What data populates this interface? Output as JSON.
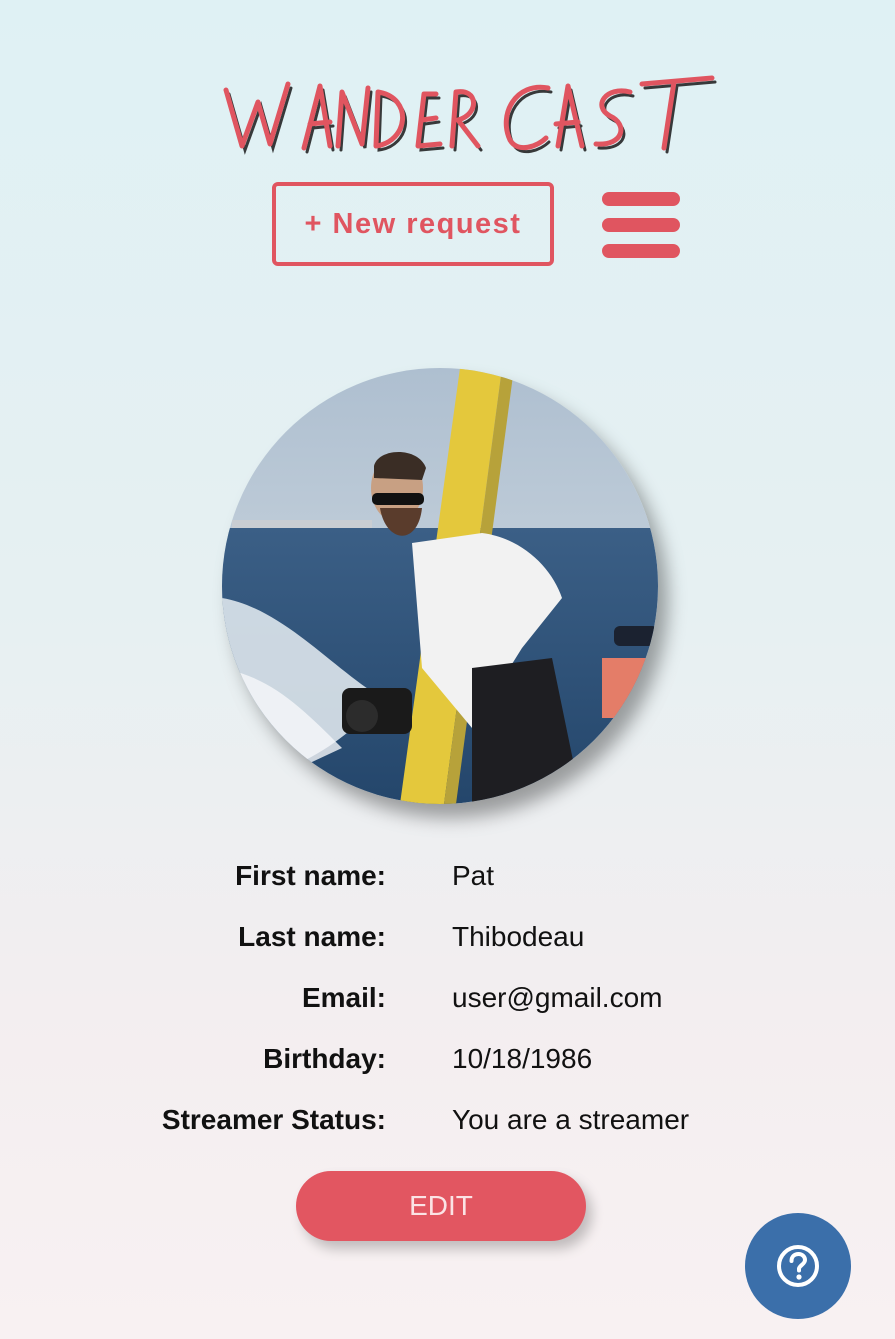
{
  "header": {
    "logo_text": "WANDERCAST",
    "new_request_label": "+ New request",
    "menu_icon": "hamburger-menu-icon"
  },
  "profile": {
    "photo": "profile-photo",
    "fields": [
      {
        "label": "First name:",
        "value": "Pat"
      },
      {
        "label": "Last name:",
        "value": "Thibodeau"
      },
      {
        "label": "Email:",
        "value": "user@gmail.com"
      },
      {
        "label": "Birthday:",
        "value": "10/18/1986"
      },
      {
        "label": "Streamer Status:",
        "value": "You are a streamer"
      }
    ],
    "edit_label": "EDIT"
  },
  "help": {
    "icon": "help-question-icon"
  },
  "colors": {
    "accent": "#e05560",
    "help_button": "#3b6faa"
  }
}
